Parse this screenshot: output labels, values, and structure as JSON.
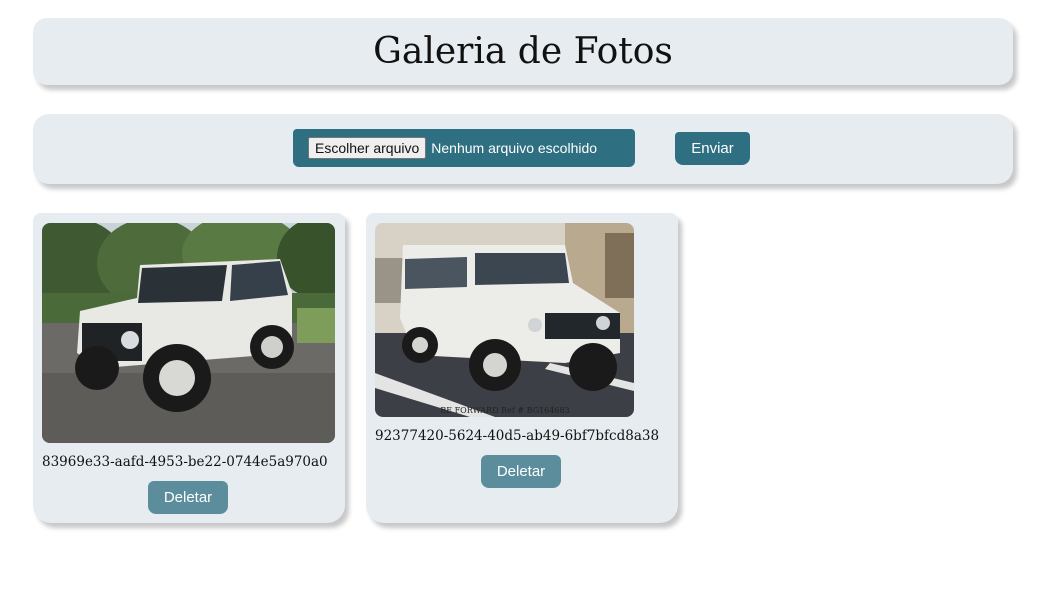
{
  "header": {
    "title": "Galeria de Fotos"
  },
  "upload": {
    "choose_label": "Escolher arquivo",
    "no_file_label": "Nenhum arquivo escolhido",
    "submit_label": "Enviar"
  },
  "gallery": {
    "photos": [
      {
        "filename": "83969e33-aafd-4953-be22-0744e5a970a0",
        "delete_label": "Deletar"
      },
      {
        "filename": "92377420-5624-40d5-ab49-6bf7bfcd8a38",
        "delete_label": "Deletar",
        "watermark": "BE FORWARD Ref # BG164683"
      }
    ]
  },
  "colors": {
    "panel_bg": "#e6ecef",
    "primary": "#2e6f82",
    "delete_button": "#5b8d9c"
  }
}
